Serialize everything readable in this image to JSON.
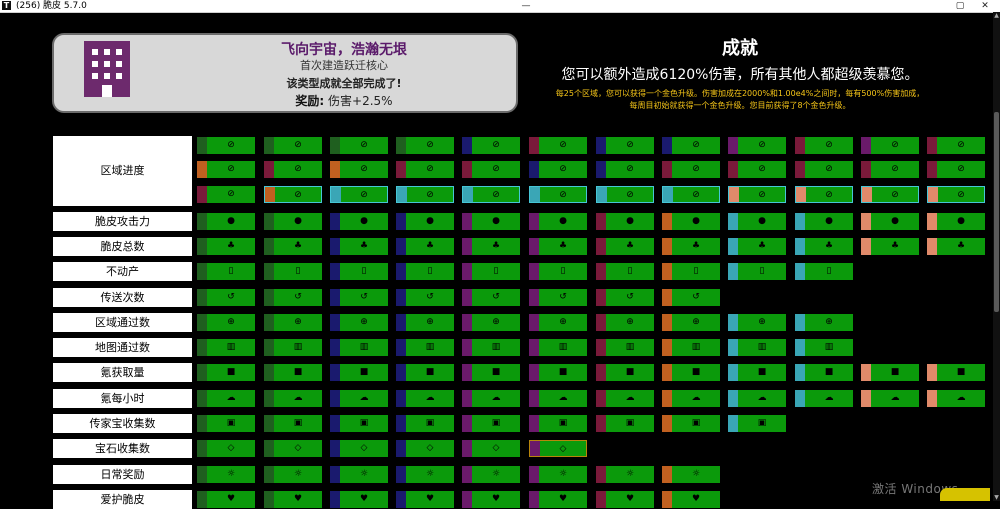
{
  "window": {
    "title": "(256) 脆皮 5.7.0",
    "icon": "T",
    "minimize": "—",
    "restore": "▢",
    "close": "✕"
  },
  "card": {
    "name": "飞向宇宙，浩瀚无垠",
    "desc": "首次建造跃迁核心",
    "status": "该类型成就全部完成了!",
    "reward_label": "奖励:",
    "reward_value": "伤害+2.5%",
    "icon": "building-icon"
  },
  "summary": {
    "title": "成就",
    "line": "您可以额外造成6120%伤害，所有其他人都超级羡慕您。",
    "note1": "每25个区域，您可以获得一个金色升级。伤害加成在2000%和1.00e4%之间时，每有500%伤害加成，",
    "note2": "每周目初始就获得一个金色升级。您目前获得了8个金色升级。"
  },
  "rows": [
    {
      "label": "区域进度",
      "icon": "compass-icon"
    },
    {
      "label": "脆皮攻击力",
      "icon": "bomb-icon"
    },
    {
      "label": "脆皮总数",
      "icon": "crowd-icon"
    },
    {
      "label": "不动产",
      "icon": "phone-icon"
    },
    {
      "label": "传送次数",
      "icon": "history-icon"
    },
    {
      "label": "区域通过数",
      "icon": "globe-icon"
    },
    {
      "label": "地图通过数",
      "icon": "map-icon"
    },
    {
      "label": "氪获取量",
      "icon": "block-icon"
    },
    {
      "label": "氪每小时",
      "icon": "cloud-icon"
    },
    {
      "label": "传家宝收集数",
      "icon": "chest-icon"
    },
    {
      "label": "宝石收集数",
      "icon": "gem-icon"
    },
    {
      "label": "日常奖励",
      "icon": "sun-icon"
    },
    {
      "label": "爱护脆皮",
      "icon": "heart-icon"
    }
  ],
  "watermark": "激活 Windows",
  "colors": {
    "tile_green": "#0b9a0b",
    "tier_darkgreen": "#1f5f1f",
    "tier_navy": "#1a1a6e",
    "tier_purple": "#6a1a6a",
    "tier_maroon": "#7a1a3a",
    "tier_orange": "#c06020",
    "tier_cyan": "#3aa6b6",
    "tier_salmon": "#e08a6a"
  }
}
